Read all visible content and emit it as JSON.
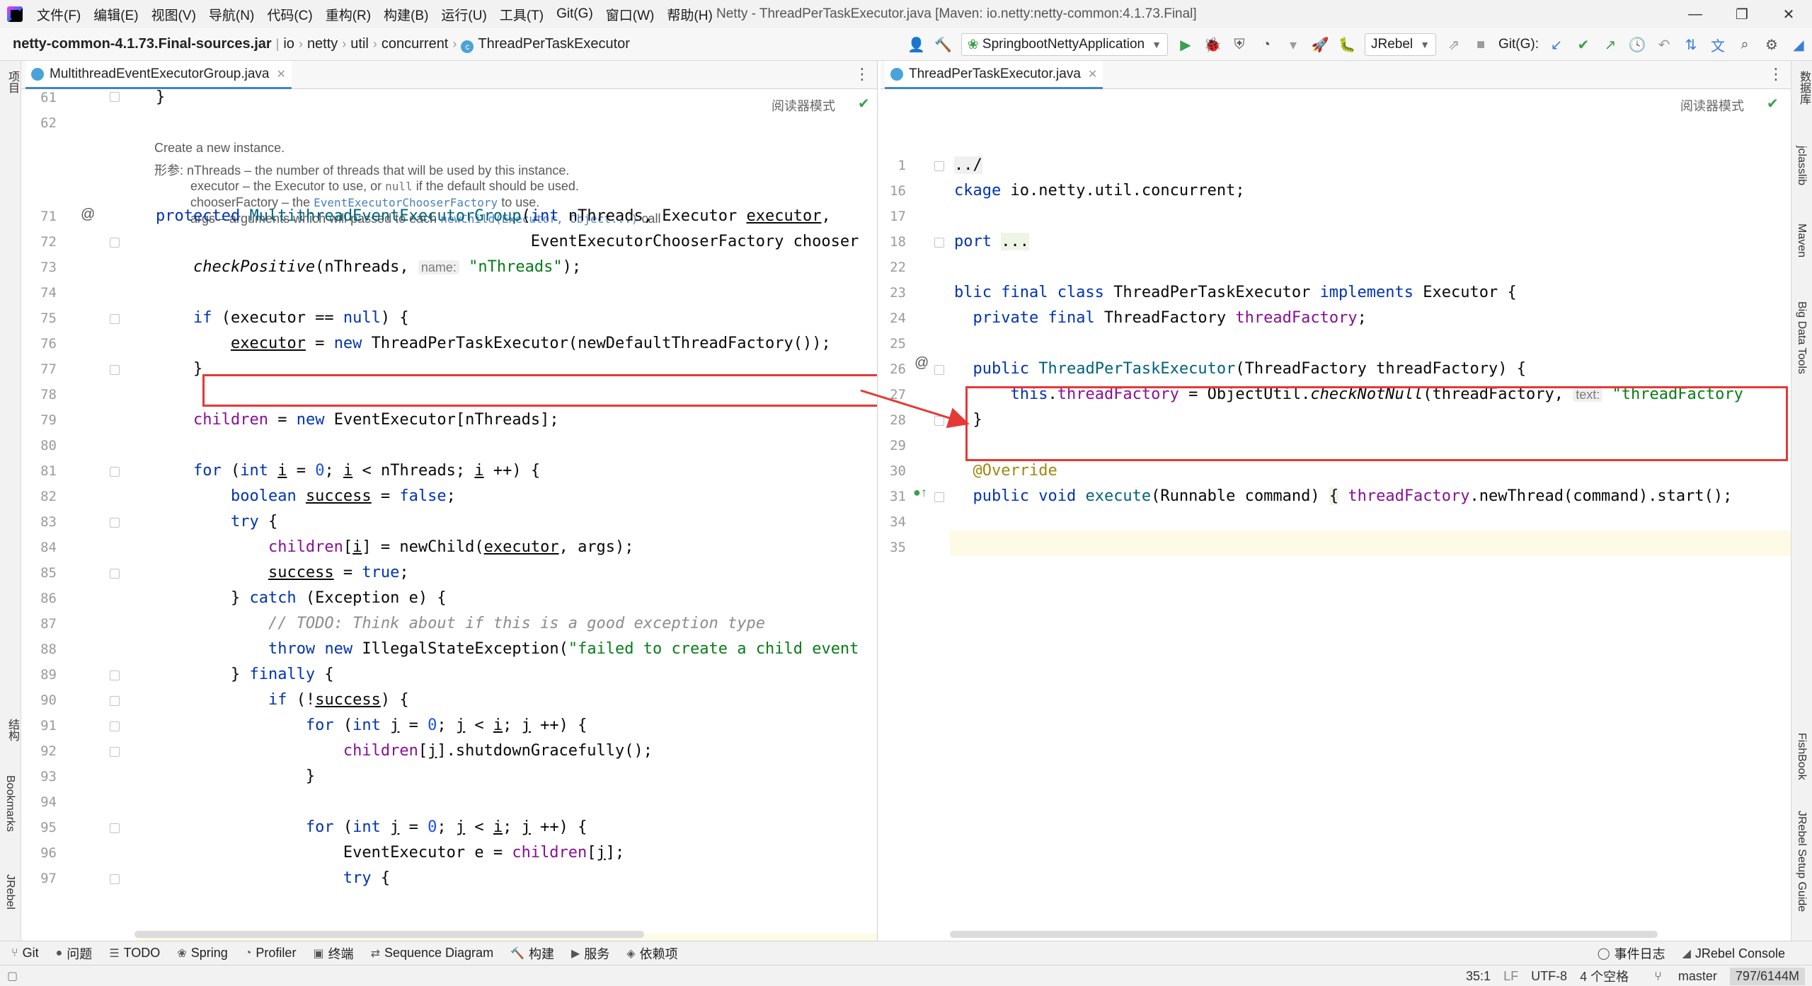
{
  "menubar": {
    "items": [
      "文件(F)",
      "编辑(E)",
      "视图(V)",
      "导航(N)",
      "代码(C)",
      "重构(R)",
      "构建(B)",
      "运行(U)",
      "工具(T)",
      "Git(G)",
      "窗口(W)",
      "帮助(H)"
    ],
    "window_title": "Netty - ThreadPerTaskExecutor.java [Maven: io.netty:netty-common:4.1.73.Final]",
    "minimize": "—",
    "restore": "❐",
    "close": "✕"
  },
  "navbar": {
    "crumbs": [
      "netty-common-4.1.73.Final-sources.jar",
      "io",
      "netty",
      "util",
      "concurrent",
      "ThreadPerTaskExecutor"
    ],
    "run_config": "SpringbootNettyApplication",
    "jrebel": "JRebel",
    "git_label": "Git(G):"
  },
  "left_strip": {
    "project": "项目",
    "structure": "结构",
    "bookmarks": "Bookmarks",
    "jrebel": "JRebel"
  },
  "right_strip": {
    "database": "数据库",
    "jclasslib": "jclasslib",
    "maven": "Maven",
    "bigdata": "Big Data Tools",
    "fishbook": "FishBook",
    "jrebel_guide": "JRebel Setup Guide"
  },
  "left_editor": {
    "tab": "MultithreadEventExecutorGroup.java",
    "reader_mode": "阅读器模式",
    "doc": {
      "summary": "Create a new instance.",
      "params_label": "形参:",
      "p1": "nThreads – the number of threads that will be used by this instance.",
      "p2a": "executor – the Executor to use, or ",
      "p2code": "null",
      "p2b": " if the default should be used.",
      "p3a": "chooserFactory – the ",
      "p3code": "EventExecutorChooserFactory",
      "p3b": " to use.",
      "p4a": "args – arguments which will passed to each ",
      "p4code": "newChild(Executor, Object...)",
      "p4b": " call"
    },
    "line_numbers": [
      "61",
      "62",
      "71",
      "72",
      "73",
      "74",
      "75",
      "76",
      "77",
      "78",
      "79",
      "80",
      "81",
      "82",
      "83",
      "84",
      "85",
      "86",
      "87",
      "88",
      "89",
      "90",
      "91",
      "92",
      "93",
      "94",
      "95",
      "96",
      "97"
    ],
    "hint_name": "name:",
    "comment": "// TODO: Think about if this is a good exception type",
    "str_nthreads": "\"nThreads\"",
    "str_failed": "\"failed to create a child event"
  },
  "right_editor": {
    "tab": "ThreadPerTaskExecutor.java",
    "reader_mode": "阅读器模式",
    "line_numbers": [
      "1",
      "16",
      "17",
      "18",
      "22",
      "23",
      "24",
      "25",
      "26",
      "27",
      "28",
      "29",
      "30",
      "31",
      "34",
      "35"
    ],
    "hint_text": "text:",
    "annotation": "@Override",
    "str_tf": "\"threadFactory"
  },
  "bottombar": {
    "items": [
      "Git",
      "问题",
      "TODO",
      "Spring",
      "Profiler",
      "终端",
      "Sequence Diagram",
      "构建",
      "服务",
      "依赖项"
    ],
    "event_log": "事件日志",
    "jrebel_console": "JRebel Console"
  },
  "statusbar": {
    "position": "35:1",
    "line_sep": "LF",
    "encoding": "UTF-8",
    "indent": "4 个空格",
    "branch": "master",
    "memory": "797/6144M"
  },
  "colors": {
    "keyword": "#0033b3",
    "field": "#871094",
    "string": "#067d17",
    "highlight_box": "#e53935"
  }
}
